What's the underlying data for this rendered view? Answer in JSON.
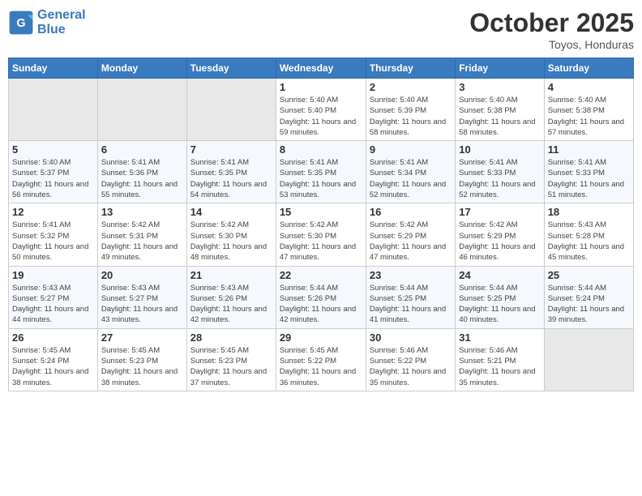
{
  "logo": {
    "line1": "General",
    "line2": "Blue"
  },
  "title": "October 2025",
  "subtitle": "Toyos, Honduras",
  "days_header": [
    "Sunday",
    "Monday",
    "Tuesday",
    "Wednesday",
    "Thursday",
    "Friday",
    "Saturday"
  ],
  "weeks": [
    [
      {
        "day": "",
        "info": ""
      },
      {
        "day": "",
        "info": ""
      },
      {
        "day": "",
        "info": ""
      },
      {
        "day": "1",
        "info": "Sunrise: 5:40 AM\nSunset: 5:40 PM\nDaylight: 11 hours\nand 59 minutes."
      },
      {
        "day": "2",
        "info": "Sunrise: 5:40 AM\nSunset: 5:39 PM\nDaylight: 11 hours\nand 58 minutes."
      },
      {
        "day": "3",
        "info": "Sunrise: 5:40 AM\nSunset: 5:38 PM\nDaylight: 11 hours\nand 58 minutes."
      },
      {
        "day": "4",
        "info": "Sunrise: 5:40 AM\nSunset: 5:38 PM\nDaylight: 11 hours\nand 57 minutes."
      }
    ],
    [
      {
        "day": "5",
        "info": "Sunrise: 5:40 AM\nSunset: 5:37 PM\nDaylight: 11 hours\nand 56 minutes."
      },
      {
        "day": "6",
        "info": "Sunrise: 5:41 AM\nSunset: 5:36 PM\nDaylight: 11 hours\nand 55 minutes."
      },
      {
        "day": "7",
        "info": "Sunrise: 5:41 AM\nSunset: 5:35 PM\nDaylight: 11 hours\nand 54 minutes."
      },
      {
        "day": "8",
        "info": "Sunrise: 5:41 AM\nSunset: 5:35 PM\nDaylight: 11 hours\nand 53 minutes."
      },
      {
        "day": "9",
        "info": "Sunrise: 5:41 AM\nSunset: 5:34 PM\nDaylight: 11 hours\nand 52 minutes."
      },
      {
        "day": "10",
        "info": "Sunrise: 5:41 AM\nSunset: 5:33 PM\nDaylight: 11 hours\nand 52 minutes."
      },
      {
        "day": "11",
        "info": "Sunrise: 5:41 AM\nSunset: 5:33 PM\nDaylight: 11 hours\nand 51 minutes."
      }
    ],
    [
      {
        "day": "12",
        "info": "Sunrise: 5:41 AM\nSunset: 5:32 PM\nDaylight: 11 hours\nand 50 minutes."
      },
      {
        "day": "13",
        "info": "Sunrise: 5:42 AM\nSunset: 5:31 PM\nDaylight: 11 hours\nand 49 minutes."
      },
      {
        "day": "14",
        "info": "Sunrise: 5:42 AM\nSunset: 5:30 PM\nDaylight: 11 hours\nand 48 minutes."
      },
      {
        "day": "15",
        "info": "Sunrise: 5:42 AM\nSunset: 5:30 PM\nDaylight: 11 hours\nand 47 minutes."
      },
      {
        "day": "16",
        "info": "Sunrise: 5:42 AM\nSunset: 5:29 PM\nDaylight: 11 hours\nand 47 minutes."
      },
      {
        "day": "17",
        "info": "Sunrise: 5:42 AM\nSunset: 5:29 PM\nDaylight: 11 hours\nand 46 minutes."
      },
      {
        "day": "18",
        "info": "Sunrise: 5:43 AM\nSunset: 5:28 PM\nDaylight: 11 hours\nand 45 minutes."
      }
    ],
    [
      {
        "day": "19",
        "info": "Sunrise: 5:43 AM\nSunset: 5:27 PM\nDaylight: 11 hours\nand 44 minutes."
      },
      {
        "day": "20",
        "info": "Sunrise: 5:43 AM\nSunset: 5:27 PM\nDaylight: 11 hours\nand 43 minutes."
      },
      {
        "day": "21",
        "info": "Sunrise: 5:43 AM\nSunset: 5:26 PM\nDaylight: 11 hours\nand 42 minutes."
      },
      {
        "day": "22",
        "info": "Sunrise: 5:44 AM\nSunset: 5:26 PM\nDaylight: 11 hours\nand 42 minutes."
      },
      {
        "day": "23",
        "info": "Sunrise: 5:44 AM\nSunset: 5:25 PM\nDaylight: 11 hours\nand 41 minutes."
      },
      {
        "day": "24",
        "info": "Sunrise: 5:44 AM\nSunset: 5:25 PM\nDaylight: 11 hours\nand 40 minutes."
      },
      {
        "day": "25",
        "info": "Sunrise: 5:44 AM\nSunset: 5:24 PM\nDaylight: 11 hours\nand 39 minutes."
      }
    ],
    [
      {
        "day": "26",
        "info": "Sunrise: 5:45 AM\nSunset: 5:24 PM\nDaylight: 11 hours\nand 38 minutes."
      },
      {
        "day": "27",
        "info": "Sunrise: 5:45 AM\nSunset: 5:23 PM\nDaylight: 11 hours\nand 38 minutes."
      },
      {
        "day": "28",
        "info": "Sunrise: 5:45 AM\nSunset: 5:23 PM\nDaylight: 11 hours\nand 37 minutes."
      },
      {
        "day": "29",
        "info": "Sunrise: 5:45 AM\nSunset: 5:22 PM\nDaylight: 11 hours\nand 36 minutes."
      },
      {
        "day": "30",
        "info": "Sunrise: 5:46 AM\nSunset: 5:22 PM\nDaylight: 11 hours\nand 35 minutes."
      },
      {
        "day": "31",
        "info": "Sunrise: 5:46 AM\nSunset: 5:21 PM\nDaylight: 11 hours\nand 35 minutes."
      },
      {
        "day": "",
        "info": ""
      }
    ]
  ]
}
